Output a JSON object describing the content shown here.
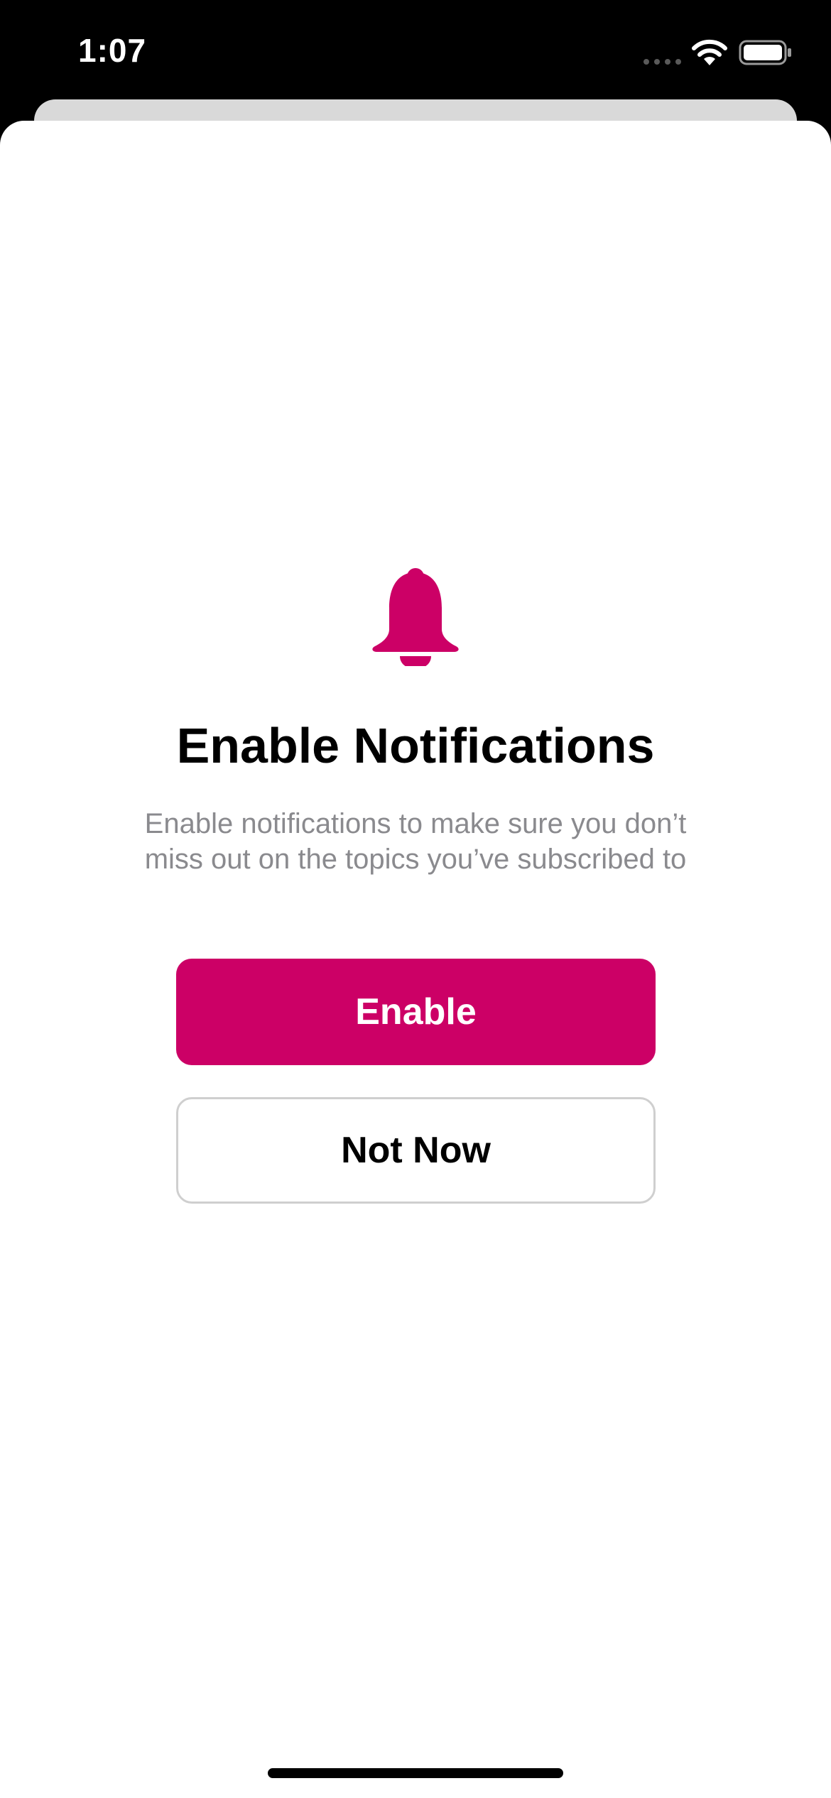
{
  "status_bar": {
    "time": "1:07",
    "icons": [
      "signal-icon",
      "wifi-icon",
      "battery-icon"
    ]
  },
  "prompt": {
    "icon": "bell-icon",
    "title": "Enable Notifications",
    "description": "Enable notifications to make sure you don’t miss out on the topics you’ve subscribed to"
  },
  "buttons": {
    "enable_label": "Enable",
    "not_now_label": "Not Now"
  },
  "colors": {
    "accent": "#cc0066",
    "title_text": "#000000",
    "description_text": "#8a8a8e",
    "secondary_button_border": "#cfcfcf"
  }
}
